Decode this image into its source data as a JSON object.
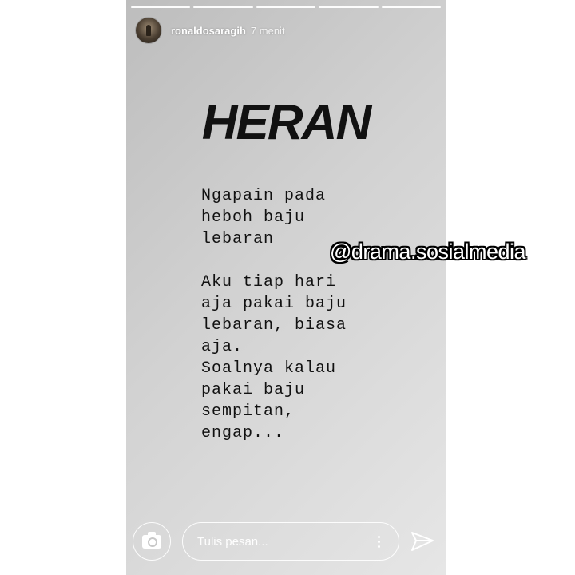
{
  "story": {
    "username": "ronaldosaragih",
    "time": "7 menit",
    "progress_segments": 5,
    "headline": "HERAN",
    "paragraphs": [
      [
        "Ngapain pada",
        "heboh baju",
        "lebaran"
      ],
      [
        "Aku tiap hari",
        "aja pakai baju",
        "lebaran, biasa",
        "aja.",
        "Soalnya kalau",
        "pakai baju",
        "sempitan,",
        "engap..."
      ]
    ]
  },
  "watermark": "@drama.sosialmedia",
  "footer": {
    "camera_icon": "camera-icon",
    "message_placeholder": "Tulis pesan...",
    "more_icon": "more-vertical-icon",
    "send_icon": "send-icon"
  },
  "colors": {
    "background_light": "#e6e6e6",
    "background_dark": "#bdbdbd",
    "text": "#111111",
    "ui": "#ffffff"
  }
}
